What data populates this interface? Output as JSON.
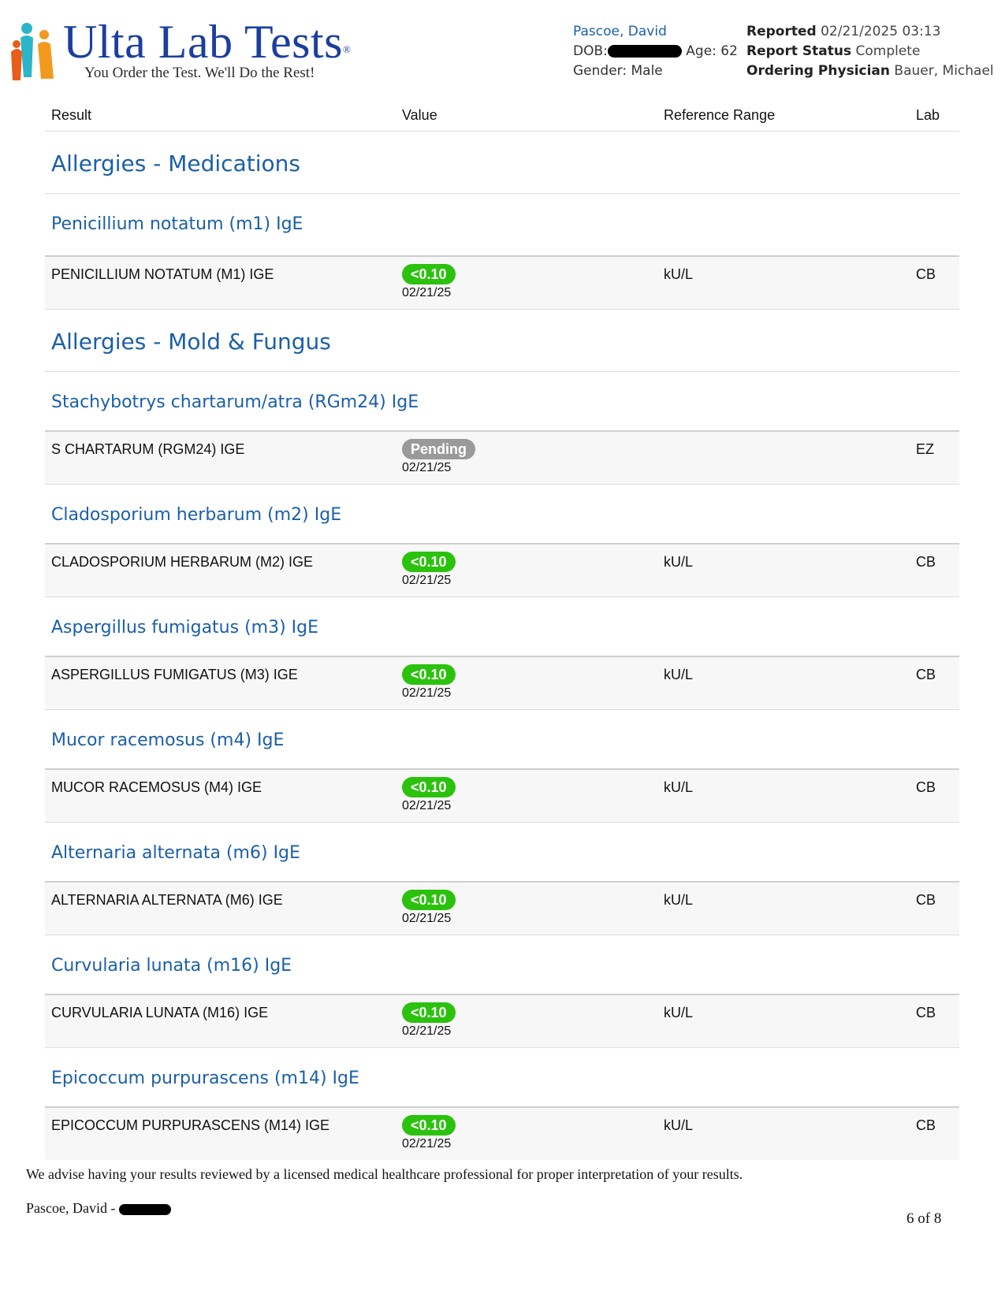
{
  "header": {
    "logo_title": "Ulta Lab Tests",
    "logo_registered": "®",
    "logo_tagline": "You Order the Test. We'll Do the Rest!",
    "patient_name": "Pascoe, David",
    "dob_label": "DOB:",
    "age_label": "Age:",
    "age_value": "62",
    "gender_label": "Gender:",
    "gender_value": "Male",
    "reported_label": "Reported",
    "reported_value": "02/21/2025 03:13",
    "status_label": "Report Status",
    "status_value": "Complete",
    "physician_label": "Ordering Physician",
    "physician_value": "Bauer, Michael"
  },
  "columns": {
    "result": "Result",
    "value": "Value",
    "range": "Reference Range",
    "lab": "Lab"
  },
  "sections": [
    {
      "category": "Allergies - Medications",
      "panels": [
        {
          "title": "Penicillium notatum (m1) IgE",
          "row": {
            "name": "PENICILLIUM NOTATUM (M1) IGE",
            "value": "<0.10",
            "status": "ok",
            "date": "02/21/25",
            "range": "kU/L",
            "lab": "CB"
          }
        }
      ]
    },
    {
      "category": "Allergies - Mold & Fungus",
      "panels": [
        {
          "title": "Stachybotrys chartarum/atra (RGm24) IgE",
          "row": {
            "name": "S CHARTARUM (RGM24) IGE",
            "value": "Pending",
            "status": "pending",
            "date": "02/21/25",
            "range": "",
            "lab": "EZ"
          }
        },
        {
          "title": "Cladosporium herbarum (m2) IgE",
          "row": {
            "name": "CLADOSPORIUM HERBARUM (M2) IGE",
            "value": "<0.10",
            "status": "ok",
            "date": "02/21/25",
            "range": "kU/L",
            "lab": "CB"
          }
        },
        {
          "title": "Aspergillus fumigatus (m3) IgE",
          "row": {
            "name": "ASPERGILLUS FUMIGATUS (M3) IGE",
            "value": "<0.10",
            "status": "ok",
            "date": "02/21/25",
            "range": "kU/L",
            "lab": "CB"
          }
        },
        {
          "title": "Mucor racemosus (m4) IgE",
          "row": {
            "name": "MUCOR RACEMOSUS (M4) IGE",
            "value": "<0.10",
            "status": "ok",
            "date": "02/21/25",
            "range": "kU/L",
            "lab": "CB"
          }
        },
        {
          "title": "Alternaria alternata (m6) IgE",
          "row": {
            "name": "ALTERNARIA ALTERNATA (M6) IGE",
            "value": "<0.10",
            "status": "ok",
            "date": "02/21/25",
            "range": "kU/L",
            "lab": "CB"
          }
        },
        {
          "title": "Curvularia lunata (m16) IgE",
          "row": {
            "name": "CURVULARIA LUNATA (M16) IGE",
            "value": "<0.10",
            "status": "ok",
            "date": "02/21/25",
            "range": "kU/L",
            "lab": "CB"
          }
        },
        {
          "title": "Epicoccum purpurascens (m14) IgE",
          "row": {
            "name": "EPICOCCUM PURPURASCENS (M14) IGE",
            "value": "<0.10",
            "status": "ok",
            "date": "02/21/25",
            "range": "kU/L",
            "lab": "CB"
          }
        }
      ]
    }
  ],
  "footer": {
    "advice": "We advise having your results reviewed by a licensed medical healthcare professional for proper interpretation of your results.",
    "patient_name": "Pascoe, David -",
    "page": "6 of 8"
  },
  "colors": {
    "heading_blue": "#1b5fa8",
    "badge_green": "#2bc20e",
    "badge_gray": "#9a9a9a",
    "logo_blue": "#1b3f9e"
  }
}
